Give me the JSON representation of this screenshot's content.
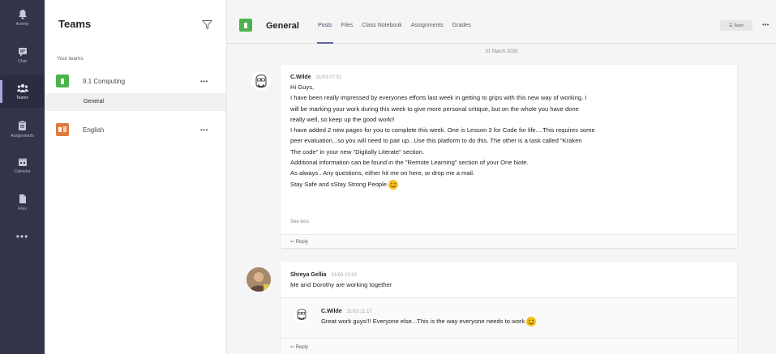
{
  "rail": {
    "items": [
      {
        "label": "Activity",
        "icon": "bell-icon"
      },
      {
        "label": "Chat",
        "icon": "chat-icon"
      },
      {
        "label": "Teams",
        "icon": "teams-icon"
      },
      {
        "label": "Assignments",
        "icon": "assignments-icon"
      },
      {
        "label": "Calendar",
        "icon": "calendar-icon"
      },
      {
        "label": "Files",
        "icon": "files-icon"
      }
    ],
    "more": "•••"
  },
  "teams_panel": {
    "title": "Teams",
    "section_label": "Your teams",
    "teams": [
      {
        "name": "9.1 Computing",
        "more": "•••",
        "color": "#4db34d"
      },
      {
        "name": "English",
        "more": "•••",
        "color": "#e07a3f"
      }
    ],
    "selected_channel": "General"
  },
  "main": {
    "channel_title": "General",
    "tabs": [
      "Posts",
      "Files",
      "Class Notebook",
      "Assignments",
      "Grades"
    ],
    "active_tab": "Posts",
    "team_pill": "☰ Team",
    "top_more": "•••",
    "date": "31 March 2020"
  },
  "posts": [
    {
      "author": "C.Wilde",
      "time": "31/03 07:51",
      "lines": [
        "Hi Guys,",
        "I have been really impressed by everyones efforts last week in getting to grips with this new way of working. I",
        "will be marking your work during this week to give more personal critique, but on the whole you have done",
        "really well, so keep up the good work!!",
        "I have added 2 new pages for you to complete this week. One is Lesson 3 for Code for life....This requires some",
        "peer evaluation...so you will need to pair up...Use this platform to do this. The other is a task called \"Kraken",
        "The code\" in your new \"Digitally Literate\" section.",
        "Additional information can be found in the \"Remote Learning\" section of your One Note.",
        "As always.. Any questions, either hit me on here, or drop me a mail.",
        "Stay Safe and sStay Strong People"
      ],
      "see_less": "See less",
      "reply": "↩ Reply"
    },
    {
      "author": "Shreya Gellia",
      "time": "31/03 10:32",
      "text": "Me and Dorothy are working together",
      "reply_author": "C.Wilde",
      "reply_time": "31/03 11:17",
      "reply_text": "Great work guys!!! Everyone else...This is the way everyone needs to work",
      "reply": "↩ Reply"
    }
  ]
}
